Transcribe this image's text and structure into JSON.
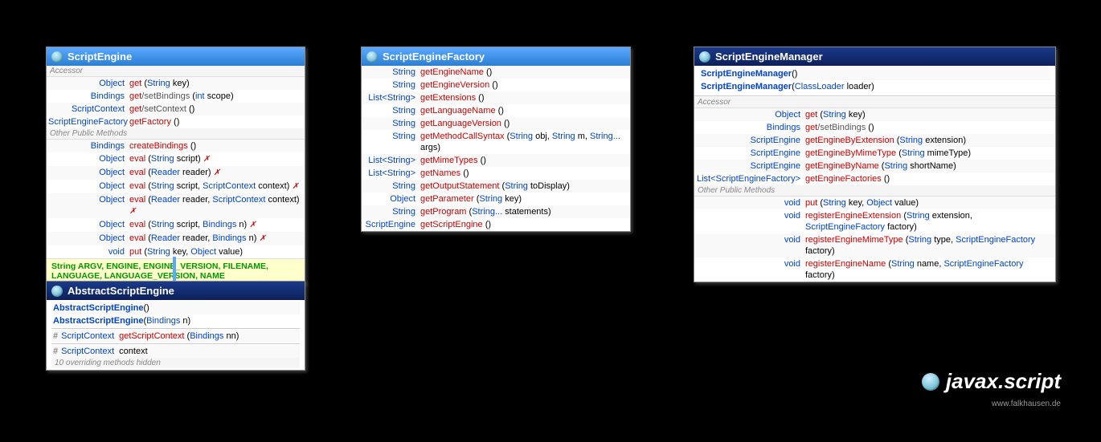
{
  "package": "javax.script",
  "credit": "www.falkhausen.de",
  "scriptEngine": {
    "title": "ScriptEngine",
    "sections": {
      "accessor": "Accessor",
      "other": "Other Public Methods"
    },
    "accRows": [
      {
        "ret": "Object",
        "name": "get",
        "params": "(String key)"
      },
      {
        "ret": "Bindings",
        "name": "get/setBindings",
        "params": "(int scope)"
      },
      {
        "ret": "ScriptContext",
        "name": "get/setContext",
        "params": "()"
      },
      {
        "ret": "ScriptEngineFactory",
        "name": "getFactory",
        "params": "()"
      }
    ],
    "pubRows": [
      {
        "ret": "Bindings",
        "name": "createBindings",
        "params": "()"
      },
      {
        "ret": "Object",
        "name": "eval",
        "params": "(String script)",
        "throws": "✗"
      },
      {
        "ret": "Object",
        "name": "eval",
        "params": "(Reader reader)",
        "throws": "✗"
      },
      {
        "ret": "Object",
        "name": "eval",
        "params": "(String script, ScriptContext context)",
        "throws": "✗"
      },
      {
        "ret": "Object",
        "name": "eval",
        "params": "(Reader reader, ScriptContext context)",
        "throws": "✗"
      },
      {
        "ret": "Object",
        "name": "eval",
        "params": "(String script, Bindings n)",
        "throws": "✗"
      },
      {
        "ret": "Object",
        "name": "eval",
        "params": "(Reader reader, Bindings n)",
        "throws": "✗"
      },
      {
        "ret": "void",
        "name": "put",
        "params": "(String key, Object value)"
      }
    ],
    "constants": "String  ARGV, ENGINE, ENGINE_VERSION, FILENAME, LANGUAGE, LANGUAGE_VERSION, NAME"
  },
  "abstractSE": {
    "title": "AbstractScriptEngine",
    "constructors": [
      {
        "name": "AbstractScriptEngine",
        "params": "()"
      },
      {
        "name": "AbstractScriptEngine",
        "params": "(Bindings n)"
      }
    ],
    "proto": "#",
    "method": {
      "ret": "ScriptContext",
      "name": "getScriptContext",
      "params": "(Bindings nn)"
    },
    "field": {
      "ret": "ScriptContext",
      "name": "context"
    },
    "hidden": "10 overriding methods hidden"
  },
  "factory": {
    "title": "ScriptEngineFactory",
    "rows": [
      {
        "ret": "String",
        "name": "getEngineName",
        "params": "()"
      },
      {
        "ret": "String",
        "name": "getEngineVersion",
        "params": "()"
      },
      {
        "ret": "List<String>",
        "name": "getExtensions",
        "params": "()"
      },
      {
        "ret": "String",
        "name": "getLanguageName",
        "params": "()"
      },
      {
        "ret": "String",
        "name": "getLanguageVersion",
        "params": "()"
      },
      {
        "ret": "String",
        "name": "getMethodCallSyntax",
        "params": "(String obj, String m, String... args)"
      },
      {
        "ret": "List<String>",
        "name": "getMimeTypes",
        "params": "()"
      },
      {
        "ret": "List<String>",
        "name": "getNames",
        "params": "()"
      },
      {
        "ret": "String",
        "name": "getOutputStatement",
        "params": "(String toDisplay)"
      },
      {
        "ret": "Object",
        "name": "getParameter",
        "params": "(String key)"
      },
      {
        "ret": "String",
        "name": "getProgram",
        "params": "(String... statements)"
      },
      {
        "ret": "ScriptEngine",
        "name": "getScriptEngine",
        "params": "()"
      }
    ]
  },
  "manager": {
    "title": "ScriptEngineManager",
    "constructors": [
      {
        "name": "ScriptEngineManager",
        "params": "()"
      },
      {
        "name": "ScriptEngineManager",
        "params": "(ClassLoader loader)"
      }
    ],
    "sections": {
      "accessor": "Accessor",
      "other": "Other Public Methods"
    },
    "accRows": [
      {
        "ret": "Object",
        "name": "get",
        "params": "(String key)"
      },
      {
        "ret": "Bindings",
        "name": "get/setBindings",
        "params": "()"
      },
      {
        "ret": "ScriptEngine",
        "name": "getEngineByExtension",
        "params": "(String extension)"
      },
      {
        "ret": "ScriptEngine",
        "name": "getEngineByMimeType",
        "params": "(String mimeType)"
      },
      {
        "ret": "ScriptEngine",
        "name": "getEngineByName",
        "params": "(String shortName)"
      },
      {
        "ret": "List<ScriptEngineFactory>",
        "name": "getEngineFactories",
        "params": "()"
      }
    ],
    "pubRows": [
      {
        "ret": "void",
        "name": "put",
        "params": "(String key, Object value)"
      },
      {
        "ret": "void",
        "name": "registerEngineExtension",
        "params": "(String extension, ScriptEngineFactory factory)"
      },
      {
        "ret": "void",
        "name": "registerEngineMimeType",
        "params": "(String type, ScriptEngineFactory factory)"
      },
      {
        "ret": "void",
        "name": "registerEngineName",
        "params": "(String name, ScriptEngineFactory factory)"
      }
    ]
  }
}
